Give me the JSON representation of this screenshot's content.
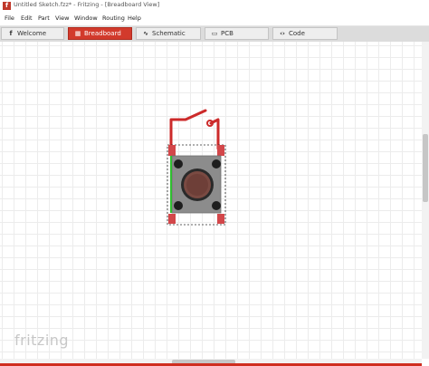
{
  "window": {
    "title": "Untitled Sketch.fzz* - Fritzing - [Breadboard View]",
    "app_icon": "fritzing-app-icon",
    "app_icon_glyph": "f"
  },
  "menu": {
    "items": [
      "File",
      "Edit",
      "Part",
      "View",
      "Window",
      "Routing",
      "Help"
    ]
  },
  "tabs": [
    {
      "label": "Welcome",
      "icon": "fritzing-f-icon",
      "glyph": "f",
      "active": false
    },
    {
      "label": "Breadboard",
      "icon": "breadboard-icon",
      "glyph": "▦",
      "active": true
    },
    {
      "label": "Schematic",
      "icon": "schematic-icon",
      "glyph": "∿",
      "active": false
    },
    {
      "label": "PCB",
      "icon": "pcb-icon",
      "glyph": "▭",
      "active": false
    },
    {
      "label": "Code",
      "icon": "code-icon",
      "glyph": "‹›",
      "active": false
    }
  ],
  "canvas": {
    "logo_text": "fritzing",
    "part": "pushbutton",
    "colors": {
      "wire": "#cc2a2a",
      "button_body": "#8c8c8c",
      "button_cap": "#7a4a42",
      "pin": "#1e1e1e",
      "selection": "#2c2c2c",
      "green_edge": "#2fbf2f"
    }
  },
  "colors": {
    "accent": "#d23a2c",
    "tab_bg": "#eeeeee",
    "tabbar_bg": "#dcdcdc",
    "grid": "#ececec"
  }
}
